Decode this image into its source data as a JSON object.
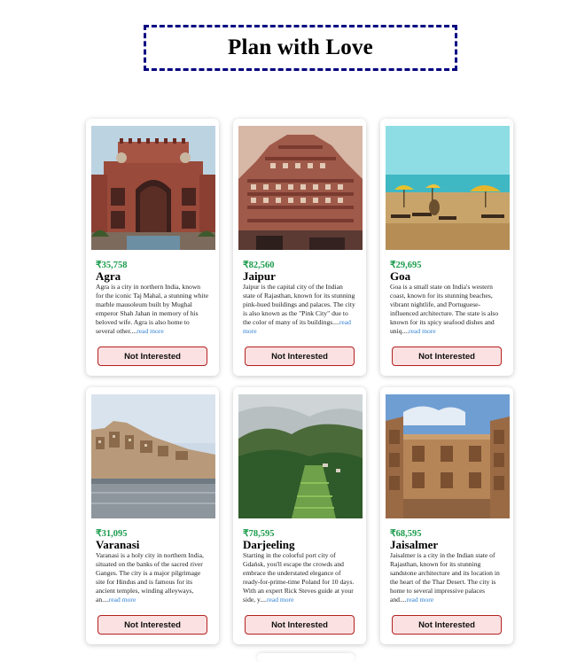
{
  "header": {
    "title": "Plan with Love"
  },
  "tours": [
    {
      "price": "₹35,758",
      "name": "Agra",
      "info": "Agra is a city in northern India, known for the iconic Taj Mahal, a stunning white marble mausoleum built by Mughal emperor Shah Jahan in memory of his beloved wife. Agra is also home to several other....",
      "read_more": "read more",
      "button": "Not Interested"
    },
    {
      "price": "₹82,560",
      "name": "Jaipur",
      "info": "Jaipur is the capital city of the Indian state of Rajasthan, known for its stunning pink-hued buildings and palaces. The city is also known as the \"Pink City\" due to the color of many of its buildings....",
      "read_more": "read more",
      "button": "Not Interested"
    },
    {
      "price": "₹29,695",
      "name": "Goa",
      "info": "Goa is a small state on India's western coast, known for its stunning beaches, vibrant nightlife, and Portuguese-influenced architecture. The state is also known for its spicy seafood dishes and uniq....",
      "read_more": "read more",
      "button": "Not Interested"
    },
    {
      "price": "₹31,095",
      "name": "Varanasi",
      "info": "Varanasi is a holy city in northern India, situated on the banks of the sacred river Ganges. The city is a major pilgrimage site for Hindus and is famous for its ancient temples, winding alleyways, an....",
      "read_more": "read more",
      "button": "Not Interested"
    },
    {
      "price": "₹78,595",
      "name": "Darjeeling",
      "info": "Starting in the colorful port city of Gdańsk, you'll escape the crowds and embrace the understated elegance of ready-for-prime-time Poland for 10 days. With an expert Rick Steves guide at your side, y....",
      "read_more": "read more",
      "button": "Not Interested"
    },
    {
      "price": "₹68,595",
      "name": "Jaisalmer",
      "info": "Jaisalmer is a city in the Indian state of Rajasthan, known for its stunning sandstone architecture and its location in the heart of the Thar Desert. The city is home to several impressive palaces and....",
      "read_more": "read more",
      "button": "Not Interested"
    }
  ],
  "colors": {
    "price": "#1a9b4b",
    "title_border": "#000080",
    "button_bg": "#fbe1e1",
    "button_border": "#b32020",
    "link": "#2f7fd3"
  }
}
